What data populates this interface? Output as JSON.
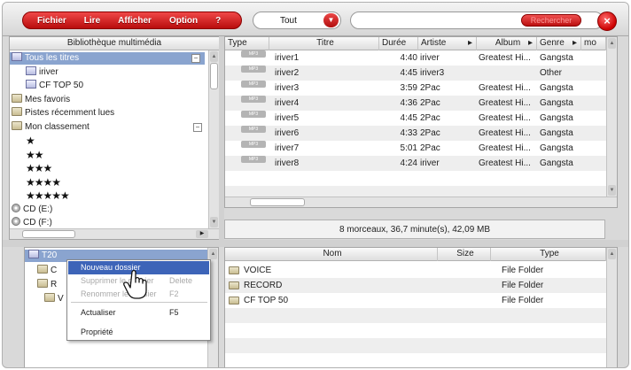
{
  "menubar": {
    "items": [
      "Fichier",
      "Lire",
      "Afficher",
      "Option",
      "?"
    ]
  },
  "toolbar": {
    "filter_value": "Tout",
    "search_value": "",
    "search_button_label": "Rechercher",
    "close_label": "×"
  },
  "library": {
    "title": "Bibliothèque multimédia",
    "items": [
      {
        "label": "Tous les titres",
        "icon": "library-icon",
        "level": 0
      },
      {
        "label": "iriver",
        "icon": "playlist-icon",
        "level": 1
      },
      {
        "label": "CF TOP 50",
        "icon": "playlist-icon",
        "level": 1
      },
      {
        "label": "Mes favoris",
        "icon": "folder-icon",
        "level": 0
      },
      {
        "label": "Pistes récemment lues",
        "icon": "folder-icon",
        "level": 0
      },
      {
        "label": "Mon classement",
        "icon": "folder-icon",
        "level": 0
      },
      {
        "label": "★",
        "icon": "",
        "level": 1
      },
      {
        "label": "★★",
        "icon": "",
        "level": 1
      },
      {
        "label": "★★★",
        "icon": "",
        "level": 1
      },
      {
        "label": "★★★★",
        "icon": "",
        "level": 1
      },
      {
        "label": "★★★★★",
        "icon": "",
        "level": 1
      },
      {
        "label": "CD (E:)",
        "icon": "cd-icon",
        "level": 0
      },
      {
        "label": "CD (F:)",
        "icon": "cd-icon",
        "level": 0
      }
    ]
  },
  "tracks": {
    "columns": [
      "Type",
      "Titre",
      "Durée",
      "Artiste",
      "Album",
      "Genre",
      "mo"
    ],
    "rows": [
      {
        "type": "MP3",
        "title": "iriver1",
        "duration": "4:40",
        "artist": "iriver",
        "album": "Greatest Hi...",
        "genre": "Gangsta"
      },
      {
        "type": "MP3",
        "title": "iriver2",
        "duration": "4:45",
        "artist": "iriver3",
        "album": "",
        "genre": "Other"
      },
      {
        "type": "MP3",
        "title": "iriver3",
        "duration": "3:59",
        "artist": "2Pac",
        "album": "Greatest Hi...",
        "genre": "Gangsta"
      },
      {
        "type": "MP3",
        "title": "iriver4",
        "duration": "4:36",
        "artist": "2Pac",
        "album": "Greatest Hi...",
        "genre": "Gangsta"
      },
      {
        "type": "MP3",
        "title": "iriver5",
        "duration": "4:45",
        "artist": "2Pac",
        "album": "Greatest Hi...",
        "genre": "Gangsta"
      },
      {
        "type": "MP3",
        "title": "iriver6",
        "duration": "4:33",
        "artist": "2Pac",
        "album": "Greatest Hi...",
        "genre": "Gangsta"
      },
      {
        "type": "MP3",
        "title": "iriver7",
        "duration": "5:01",
        "artist": "2Pac",
        "album": "Greatest Hi...",
        "genre": "Gangsta"
      },
      {
        "type": "MP3",
        "title": "iriver8",
        "duration": "4:24",
        "artist": "iriver",
        "album": "Greatest Hi...",
        "genre": "Gangsta"
      }
    ],
    "summary": "8 morceaux, 36,7 minute(s), 42,09 MB"
  },
  "explorer": {
    "root_label": "T20",
    "tree_items": [
      "C",
      "R",
      "V"
    ]
  },
  "files": {
    "columns": [
      "Nom",
      "Size",
      "Type"
    ],
    "rows": [
      {
        "name": "VOICE",
        "size": "",
        "type": "File Folder"
      },
      {
        "name": "RECORD",
        "size": "",
        "type": "File Folder"
      },
      {
        "name": "CF TOP 50",
        "size": "",
        "type": "File Folder"
      }
    ]
  },
  "context_menu": {
    "items": [
      {
        "label": "Nouveau dossier",
        "shortcut": "",
        "state": "highlight"
      },
      {
        "label": "Supprimer le dossier",
        "shortcut": "Delete",
        "state": "disabled"
      },
      {
        "label": "Renommer le dossier",
        "shortcut": "F2",
        "state": "disabled"
      },
      {
        "label": "Actualiser",
        "shortcut": "F5",
        "state": "normal"
      },
      {
        "label": "Propriété",
        "shortcut": "",
        "state": "normal"
      }
    ]
  }
}
